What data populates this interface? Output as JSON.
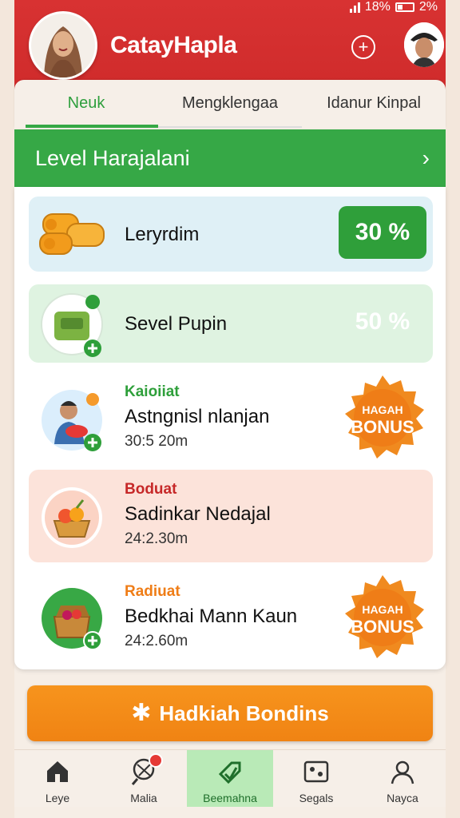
{
  "status": {
    "battery_text": "18%",
    "extra_text": "2%"
  },
  "header": {
    "app_title": "CatayHapla",
    "add_icon": "plus-circle-icon"
  },
  "tabs": [
    {
      "label": "Neuk",
      "active": true
    },
    {
      "label": "Mengklengaa",
      "active": false
    },
    {
      "label": "Idanur Kinpal",
      "active": false
    }
  ],
  "banner": {
    "title": "Level Harajalani"
  },
  "list": [
    {
      "title": "Leryrdim",
      "badge": "30 %",
      "icon": "money-rolls-icon"
    },
    {
      "title": "Sevel Pupin",
      "badge": "50 %",
      "icon": "vegetable-basket-icon"
    },
    {
      "tag": "Kaioiiat",
      "title": "Astngnisl nlanjan",
      "time": "30:5 20m",
      "icon": "person-with-fruit-icon",
      "bonus_top": "HAGAH",
      "bonus_main": "BONUS"
    },
    {
      "tag": "Boduat",
      "title": "Sadinkar Nedajal",
      "time": "24:2.30m",
      "icon": "fruit-basket-icon"
    },
    {
      "tag": "Radiuat",
      "title": "Bedkhai Mann Kaun",
      "time": "24:2.60m",
      "icon": "picnic-basket-icon",
      "bonus_top": "HAGAH",
      "bonus_main": "BONUS"
    }
  ],
  "colors": {
    "header": "#d83232",
    "accent_green": "#36a846",
    "orange": "#f7941d"
  },
  "bonus_button": {
    "label": "Hadkiah Bondins"
  },
  "nav": [
    {
      "label": "Leye",
      "icon": "home-icon"
    },
    {
      "label": "Malia",
      "icon": "whisk-icon"
    },
    {
      "label": "Beemahna",
      "icon": "tag-icon",
      "active": true
    },
    {
      "label": "Segals",
      "icon": "photo-icon"
    },
    {
      "label": "Nayca",
      "icon": "profile-icon"
    }
  ]
}
